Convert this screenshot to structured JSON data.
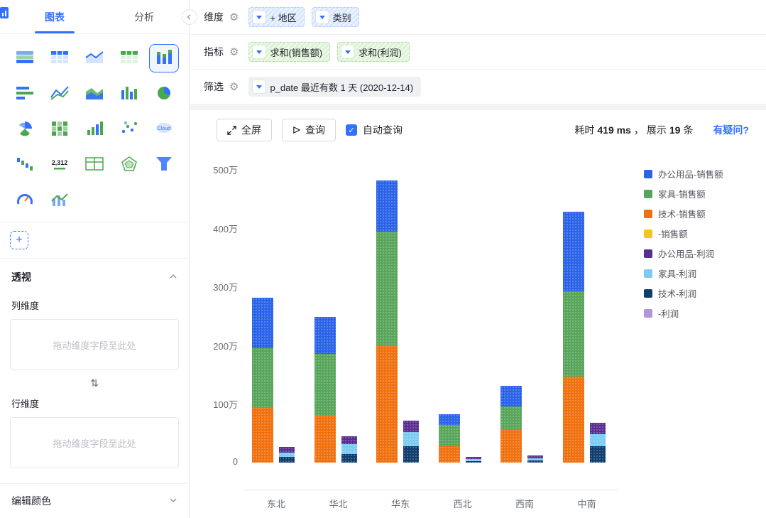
{
  "sidebar": {
    "tabs": [
      {
        "label": "图表"
      },
      {
        "label": "分析"
      }
    ],
    "chart_types": [
      {
        "name": "stacked-area-chart",
        "type": "area"
      },
      {
        "name": "table-chart",
        "type": "table"
      },
      {
        "name": "line-area-chart",
        "type": "linearea"
      },
      {
        "name": "grid-table-chart",
        "type": "table2"
      },
      {
        "name": "stacked-column-chart",
        "type": "bar",
        "selected": true
      },
      {
        "name": "horizontal-bar-chart",
        "type": "hbar"
      },
      {
        "name": "line-chart",
        "type": "line"
      },
      {
        "name": "filled-area-chart",
        "type": "area2"
      },
      {
        "name": "column-chart",
        "type": "bar2"
      },
      {
        "name": "pie-chart",
        "type": "pie"
      },
      {
        "name": "rose-chart",
        "type": "rose"
      },
      {
        "name": "heatmap-chart",
        "type": "heatmap"
      },
      {
        "name": "progress-chart",
        "type": "bars"
      },
      {
        "name": "scatter-chart",
        "type": "scatter"
      },
      {
        "name": "word-cloud-chart",
        "type": "cloud",
        "text": "Cloud"
      },
      {
        "name": "waterfall-chart",
        "type": "bars2"
      },
      {
        "name": "metric-card-chart",
        "type": "number",
        "text": "2,312"
      },
      {
        "name": "pivot-table-chart",
        "type": "table3"
      },
      {
        "name": "radar-chart",
        "type": "radar"
      },
      {
        "name": "funnel-chart",
        "type": "funnel"
      },
      {
        "name": "gauge-chart",
        "type": "gauge"
      },
      {
        "name": "combo-chart",
        "type": "combo"
      }
    ],
    "add_button": "+",
    "pivot": {
      "title": "透视",
      "col_label": "列维度",
      "row_label": "行维度",
      "dropzone_hint": "拖动维度字段至此处"
    },
    "edit_color": "编辑颜色"
  },
  "config": {
    "dimension": {
      "label": "维度",
      "pills": [
        "+ 地区",
        "类别"
      ]
    },
    "metric": {
      "label": "指标",
      "pills": [
        "求和(销售额)",
        "求和(利润)"
      ]
    },
    "filter": {
      "label": "筛选",
      "pills": [
        "p_date 最近有数 1 天 (2020-12-14)"
      ]
    }
  },
  "toolbar": {
    "fullscreen": "全屏",
    "query": "查询",
    "auto_query": "自动查询",
    "elapsed_label": "耗时",
    "elapsed_value": "419 ms",
    "comma": "，",
    "display_label": "展示",
    "display_value": "19",
    "display_unit": "条",
    "help_link": "有疑问?"
  },
  "chart_data": {
    "type": "bar",
    "stacked": true,
    "unit": "万",
    "title": "",
    "categories": [
      "东北",
      "华北",
      "华东",
      "西北",
      "西南",
      "中南"
    ],
    "series": [
      {
        "name": "办公用品-销售额",
        "color": "#2A62E8",
        "values": [
          86,
          63,
          88,
          18,
          35,
          135
        ]
      },
      {
        "name": "家具-销售额",
        "color": "#57A55A",
        "values": [
          100,
          105,
          193,
          36,
          39,
          145
        ]
      },
      {
        "name": "技术-销售额",
        "color": "#F1700E",
        "values": [
          95,
          80,
          200,
          28,
          57,
          147
        ]
      },
      {
        "name": "-销售额",
        "color": "#F5C518",
        "values": [
          0,
          0,
          0,
          0,
          0,
          0
        ]
      },
      {
        "name": "办公用品-利润",
        "color": "#5B2D91",
        "values": [
          10,
          13,
          20,
          4,
          5,
          20
        ]
      },
      {
        "name": "家具-利润",
        "color": "#7CCBF2",
        "values": [
          7,
          17,
          24,
          3,
          3,
          20
        ]
      },
      {
        "name": "技术-利润",
        "color": "#0F3D6E",
        "values": [
          10,
          15,
          28,
          3,
          4,
          28
        ]
      },
      {
        "name": "-利润",
        "color": "#B493D6",
        "values": [
          0,
          0,
          0,
          0,
          0,
          0
        ]
      }
    ],
    "stacks": {
      "sales": [
        "技术-销售额",
        "家具-销售额",
        "办公用品-销售额",
        "-销售额"
      ],
      "profit": [
        "技术-利润",
        "家具-利润",
        "办公用品-利润",
        "-利润"
      ]
    },
    "y_ticks": [
      {
        "v": 0,
        "label": "0"
      },
      {
        "v": 100,
        "label": "100万"
      },
      {
        "v": 200,
        "label": "200万"
      },
      {
        "v": 300,
        "label": "300万"
      },
      {
        "v": 400,
        "label": "400万"
      },
      {
        "v": 500,
        "label": "500万"
      }
    ],
    "ylim": [
      0,
      500
    ],
    "legend_position": "right",
    "grid": false
  }
}
